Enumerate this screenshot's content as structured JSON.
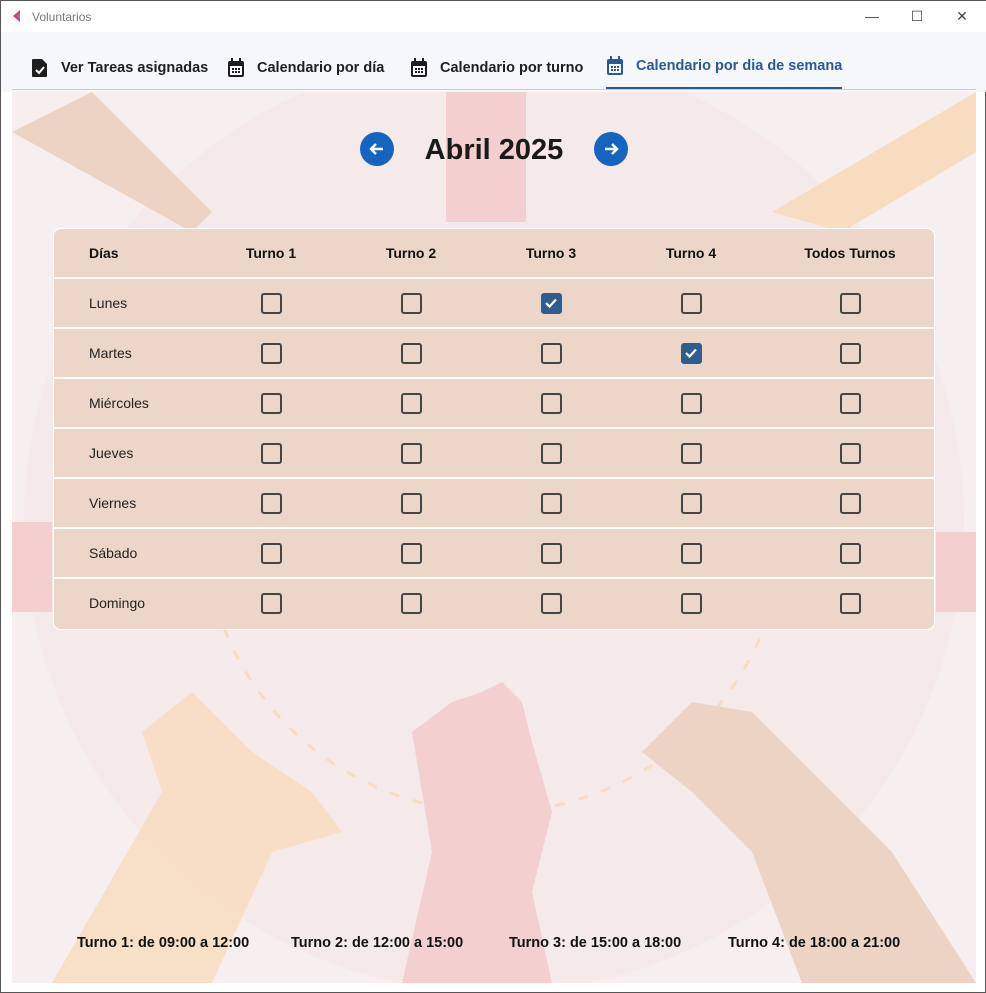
{
  "window": {
    "title": "Voluntarios"
  },
  "tabs": [
    {
      "label": "Ver Tareas asignadas",
      "icon": "file-check-icon",
      "active": false
    },
    {
      "label": "Calendario por día",
      "icon": "calendar-icon",
      "active": false
    },
    {
      "label": "Calendario por turno",
      "icon": "calendar-icon",
      "active": false
    },
    {
      "label": "Calendario por dia de semana",
      "icon": "calendar-icon",
      "active": true
    }
  ],
  "header": {
    "month": "Abril 2025",
    "prev": "arrow-left-icon",
    "next": "arrow-right-icon"
  },
  "table": {
    "columns": [
      "Días",
      "Turno 1",
      "Turno 2",
      "Turno 3",
      "Turno 4",
      "Todos Turnos"
    ],
    "rows": [
      {
        "day": "Lunes",
        "checks": [
          false,
          false,
          true,
          false,
          false
        ]
      },
      {
        "day": "Martes",
        "checks": [
          false,
          false,
          false,
          true,
          false
        ]
      },
      {
        "day": "Miércoles",
        "checks": [
          false,
          false,
          false,
          false,
          false
        ]
      },
      {
        "day": "Jueves",
        "checks": [
          false,
          false,
          false,
          false,
          false
        ]
      },
      {
        "day": "Viernes",
        "checks": [
          false,
          false,
          false,
          false,
          false
        ]
      },
      {
        "day": "Sábado",
        "checks": [
          false,
          false,
          false,
          false,
          false
        ]
      },
      {
        "day": "Domingo",
        "checks": [
          false,
          false,
          false,
          false,
          false
        ]
      }
    ]
  },
  "footer": [
    "Turno 1: de 09:00 a 12:00",
    "Turno 2: de 12:00 a 15:00",
    "Turno 3: de 15:00 a 18:00",
    "Turno 4: de 18:00 a 21:00"
  ],
  "colors": {
    "accent": "#2a5a96",
    "arrow": "#1565c0",
    "table_bg": "#ecd6c9",
    "checked": "#2f5d90"
  }
}
